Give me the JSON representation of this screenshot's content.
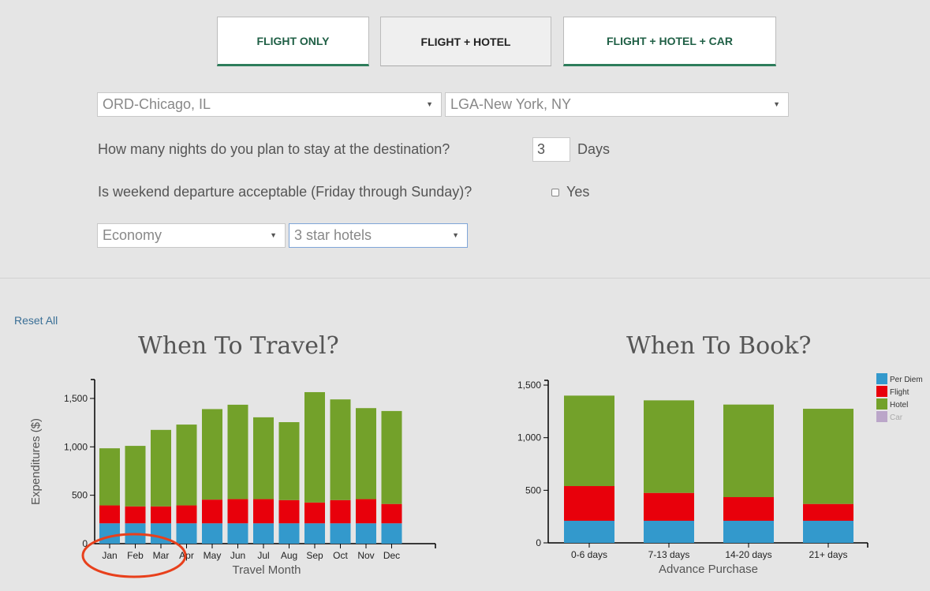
{
  "tabs": [
    {
      "label": "FLIGHT ONLY",
      "active": false
    },
    {
      "label": "FLIGHT + HOTEL",
      "active": true
    },
    {
      "label": "FLIGHT + HOTEL + CAR",
      "active": false
    }
  ],
  "form": {
    "origin": "ORD-Chicago, IL",
    "destination": "LGA-New York, NY",
    "nights_question": "How many nights do you plan to stay at the destination?",
    "nights_value": "3",
    "nights_unit": "Days",
    "weekend_question": "Is weekend departure acceptable (Friday through Sunday)?",
    "weekend_option": "Yes",
    "cabin_class": "Economy",
    "hotel_class": "3 star hotels"
  },
  "reset_label": "Reset All",
  "colors": {
    "per_diem": "#3399cc",
    "flight": "#e8000b",
    "hotel": "#73a12a",
    "car": "#bba6c9"
  },
  "chart_data": [
    {
      "type": "bar",
      "stacked": true,
      "title": "When To Travel?",
      "xlabel": "Travel Month",
      "ylabel": "Expenditures ($)",
      "categories": [
        "Jan",
        "Feb",
        "Mar",
        "Apr",
        "May",
        "Jun",
        "Jul",
        "Aug",
        "Sep",
        "Oct",
        "Nov",
        "Dec"
      ],
      "yticks": [
        0,
        500,
        1000,
        1500
      ],
      "ytick_labels": [
        "0",
        "500",
        "1,000",
        "1,500"
      ],
      "ylim": [
        0,
        1700
      ],
      "series": [
        {
          "name": "Per Diem",
          "color": "#3399cc",
          "values": [
            210,
            210,
            210,
            210,
            210,
            210,
            210,
            210,
            210,
            210,
            210,
            210
          ]
        },
        {
          "name": "Flight",
          "color": "#e8000b",
          "values": [
            185,
            175,
            175,
            185,
            245,
            250,
            250,
            240,
            215,
            240,
            250,
            200
          ]
        },
        {
          "name": "Hotel",
          "color": "#73a12a",
          "values": [
            590,
            625,
            790,
            835,
            935,
            975,
            845,
            805,
            1140,
            1040,
            940,
            960
          ]
        }
      ],
      "annotation": "circle around Jan, Feb, Mar"
    },
    {
      "type": "bar",
      "stacked": true,
      "title": "When To Book?",
      "xlabel": "Advance Purchase",
      "ylabel": "",
      "categories": [
        "0-6 days",
        "7-13 days",
        "14-20 days",
        "21+ days"
      ],
      "yticks": [
        0,
        500,
        1000,
        1500
      ],
      "ytick_labels": [
        "0",
        "500",
        "1,000",
        "1,500"
      ],
      "ylim": [
        0,
        1500
      ],
      "series": [
        {
          "name": "Per Diem",
          "color": "#3399cc",
          "values": [
            210,
            210,
            210,
            210
          ]
        },
        {
          "name": "Flight",
          "color": "#e8000b",
          "values": [
            330,
            265,
            225,
            160
          ]
        },
        {
          "name": "Hotel",
          "color": "#73a12a",
          "values": [
            860,
            880,
            880,
            905
          ]
        }
      ],
      "legend": {
        "position": "top-right",
        "items": [
          {
            "label": "Per Diem",
            "color": "#3399cc"
          },
          {
            "label": "Flight",
            "color": "#e8000b"
          },
          {
            "label": "Hotel",
            "color": "#73a12a"
          },
          {
            "label": "Car",
            "color": "#bba6c9"
          }
        ]
      }
    }
  ]
}
